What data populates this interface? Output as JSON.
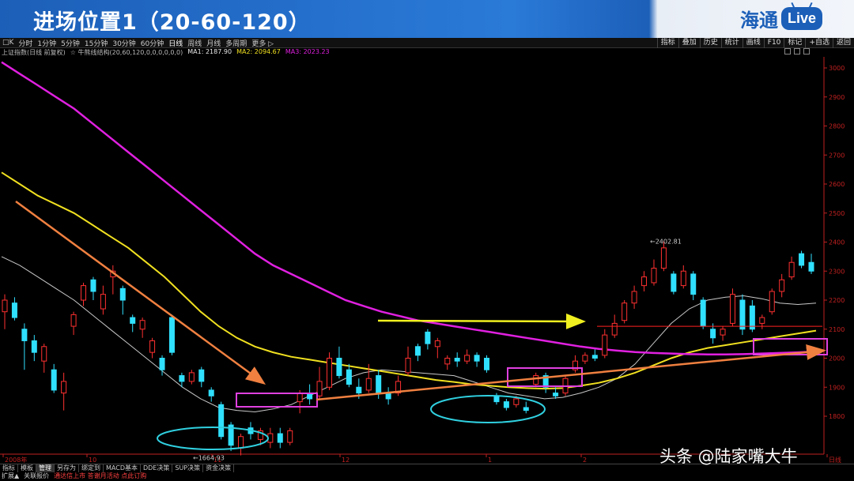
{
  "banner": {
    "title": "进场位置1（20-60-120）",
    "logo_text": "海通",
    "logo_badge": "Live"
  },
  "toolbar": {
    "left_marker": "□K",
    "periods": [
      "分时",
      "1分钟",
      "5分钟",
      "15分钟",
      "30分钟",
      "60分钟",
      "日线",
      "周线",
      "月线",
      "多周期",
      "更多 ▷"
    ],
    "active_period": "日线",
    "right_buttons": [
      "指标",
      "叠加",
      "历史",
      "统计",
      "画线",
      "F10",
      "标记",
      "+自选",
      "返回"
    ]
  },
  "infobar": {
    "index_name": "上证指数(日线 前复权)",
    "indicator": "☆ 牛熊线结构(20,60,120,0,0,0,0,0,0)",
    "ma1": "MA1: 2187.90",
    "ma2": "MA2: 2094.67",
    "ma3": "MA3: 2023.23"
  },
  "bottom_tabs": [
    "指标",
    "模板",
    "管理",
    "另存为",
    "绑定到",
    "MACD基本",
    "DDE决策",
    "SUP决策",
    "资金决策"
  ],
  "active_bottom_tab": "管理",
  "status_bar": {
    "item1": "扩展▲",
    "item2": "关联报价",
    "item3": "通达信上市 答谢月活动 点此订购"
  },
  "watermark": "头条 @陆家嘴大牛",
  "colors": {
    "up": "#ff3030",
    "down": "#30e0ff",
    "ma1": "#c8c8c8",
    "ma2": "#f0e020",
    "ma3": "#e020e0",
    "axis": "#c02020",
    "grid_text": "#c02020",
    "highlight_box": "#e040e0",
    "oval": "#30d0e0",
    "arrow_orange": "#f08040",
    "arrow_yellow": "#f0f020"
  },
  "chart_data": {
    "type": "candlestick",
    "title": "上证指数(日线 前复权)",
    "ylim": [
      1600,
      3050
    ],
    "y_ticks": [
      1800,
      1900,
      2000,
      2100,
      2200,
      2300,
      2400,
      2500,
      2600,
      2700,
      2800,
      2900,
      3000
    ],
    "x_tick_labels": [
      "2008年",
      "10",
      "11",
      "12",
      "1",
      "2",
      "日线"
    ],
    "annotations": {
      "low_label": "←1664.93",
      "high_label": "←2402.81",
      "low_value": 1664.93,
      "high_value": 2402.81
    },
    "ma_series": [
      {
        "name": "MA1",
        "values": [
          2350,
          2320,
          2280,
          2240,
          2200,
          2150,
          2100,
          2050,
          2000,
          1950,
          1900,
          1860,
          1830,
          1820,
          1815,
          1825,
          1840,
          1870,
          1900,
          1930,
          1950,
          1960,
          1955,
          1950,
          1945,
          1940,
          1920,
          1900,
          1880,
          1870,
          1860,
          1865,
          1880,
          1900,
          1930,
          1980,
          2050,
          2120,
          2170,
          2200,
          2210,
          2215,
          2205,
          2190,
          2185,
          2190
        ]
      },
      {
        "name": "MA2",
        "values": [
          2640,
          2600,
          2560,
          2530,
          2500,
          2460,
          2420,
          2380,
          2330,
          2280,
          2220,
          2160,
          2110,
          2070,
          2040,
          2020,
          2005,
          1995,
          1985,
          1975,
          1965,
          1955,
          1945,
          1935,
          1925,
          1918,
          1910,
          1905,
          1900,
          1897,
          1895,
          1897,
          1905,
          1915,
          1930,
          1950,
          1975,
          2000,
          2020,
          2035,
          2045,
          2055,
          2065,
          2075,
          2085,
          2095
        ]
      },
      {
        "name": "MA3",
        "values": [
          3020,
          2980,
          2940,
          2900,
          2860,
          2810,
          2760,
          2710,
          2660,
          2610,
          2560,
          2510,
          2460,
          2410,
          2360,
          2320,
          2290,
          2260,
          2230,
          2200,
          2180,
          2160,
          2145,
          2130,
          2120,
          2110,
          2100,
          2090,
          2080,
          2070,
          2060,
          2050,
          2040,
          2032,
          2026,
          2021,
          2018,
          2016,
          2014,
          2013,
          2013,
          2014,
          2016,
          2018,
          2020,
          2023
        ]
      }
    ],
    "candles": [
      {
        "o": 2160,
        "c": 2200,
        "h": 2220,
        "l": 2100
      },
      {
        "o": 2190,
        "c": 2140,
        "h": 2210,
        "l": 2130
      },
      {
        "o": 2100,
        "c": 2060,
        "h": 2120,
        "l": 1960
      },
      {
        "o": 2060,
        "c": 2020,
        "h": 2080,
        "l": 1990
      },
      {
        "o": 1990,
        "c": 2040,
        "h": 2050,
        "l": 1950
      },
      {
        "o": 1960,
        "c": 1890,
        "h": 1980,
        "l": 1880
      },
      {
        "o": 1880,
        "c": 1920,
        "h": 1950,
        "l": 1820
      },
      {
        "o": 2110,
        "c": 2150,
        "h": 2160,
        "l": 2080
      },
      {
        "o": 2200,
        "c": 2250,
        "h": 2260,
        "l": 2180
      },
      {
        "o": 2270,
        "c": 2230,
        "h": 2280,
        "l": 2200
      },
      {
        "o": 2170,
        "c": 2220,
        "h": 2250,
        "l": 2150
      },
      {
        "o": 2280,
        "c": 2300,
        "h": 2320,
        "l": 2220
      },
      {
        "o": 2240,
        "c": 2200,
        "h": 2250,
        "l": 2150
      },
      {
        "o": 2140,
        "c": 2120,
        "h": 2150,
        "l": 2090
      },
      {
        "o": 2100,
        "c": 2130,
        "h": 2140,
        "l": 2070
      },
      {
        "o": 2020,
        "c": 2060,
        "h": 2070,
        "l": 2000
      },
      {
        "o": 2000,
        "c": 1960,
        "h": 2010,
        "l": 1940
      },
      {
        "o": 2140,
        "c": 2020,
        "h": 2150,
        "l": 2010
      },
      {
        "o": 1940,
        "c": 1920,
        "h": 1950,
        "l": 1900
      },
      {
        "o": 1920,
        "c": 1950,
        "h": 1960,
        "l": 1910
      },
      {
        "o": 1960,
        "c": 1920,
        "h": 1970,
        "l": 1900
      },
      {
        "o": 1890,
        "c": 1870,
        "h": 1900,
        "l": 1850
      },
      {
        "o": 1840,
        "c": 1730,
        "h": 1850,
        "l": 1720
      },
      {
        "o": 1770,
        "c": 1700,
        "h": 1780,
        "l": 1680
      },
      {
        "o": 1690,
        "c": 1730,
        "h": 1740,
        "l": 1665
      },
      {
        "o": 1760,
        "c": 1740,
        "h": 1780,
        "l": 1720
      },
      {
        "o": 1720,
        "c": 1750,
        "h": 1760,
        "l": 1700
      },
      {
        "o": 1710,
        "c": 1740,
        "h": 1760,
        "l": 1690
      },
      {
        "o": 1740,
        "c": 1710,
        "h": 1760,
        "l": 1690
      },
      {
        "o": 1710,
        "c": 1750,
        "h": 1760,
        "l": 1700
      },
      {
        "o": 1850,
        "c": 1880,
        "h": 1890,
        "l": 1810
      },
      {
        "o": 1880,
        "c": 1860,
        "h": 1910,
        "l": 1840
      },
      {
        "o": 1870,
        "c": 1920,
        "h": 1970,
        "l": 1860
      },
      {
        "o": 1900,
        "c": 2000,
        "h": 2020,
        "l": 1890
      },
      {
        "o": 2000,
        "c": 1940,
        "h": 2040,
        "l": 1930
      },
      {
        "o": 1960,
        "c": 1910,
        "h": 1980,
        "l": 1900
      },
      {
        "o": 1900,
        "c": 1880,
        "h": 1930,
        "l": 1860
      },
      {
        "o": 1890,
        "c": 1930,
        "h": 1980,
        "l": 1880
      },
      {
        "o": 1940,
        "c": 1880,
        "h": 1960,
        "l": 1860
      },
      {
        "o": 1880,
        "c": 1860,
        "h": 1900,
        "l": 1840
      },
      {
        "o": 1880,
        "c": 1920,
        "h": 1940,
        "l": 1870
      },
      {
        "o": 1950,
        "c": 2000,
        "h": 2040,
        "l": 1940
      },
      {
        "o": 2040,
        "c": 2010,
        "h": 2050,
        "l": 1990
      },
      {
        "o": 2090,
        "c": 2050,
        "h": 2100,
        "l": 2030
      },
      {
        "o": 2040,
        "c": 2060,
        "h": 2070,
        "l": 2000
      },
      {
        "o": 1980,
        "c": 2000,
        "h": 2010,
        "l": 1960
      },
      {
        "o": 2000,
        "c": 1990,
        "h": 2020,
        "l": 1970
      },
      {
        "o": 1990,
        "c": 2010,
        "h": 2030,
        "l": 1980
      },
      {
        "o": 2010,
        "c": 1990,
        "h": 2020,
        "l": 1970
      },
      {
        "o": 2000,
        "c": 1960,
        "h": 2010,
        "l": 1950
      },
      {
        "o": 1870,
        "c": 1850,
        "h": 1880,
        "l": 1840
      },
      {
        "o": 1850,
        "c": 1830,
        "h": 1860,
        "l": 1820
      },
      {
        "o": 1840,
        "c": 1860,
        "h": 1870,
        "l": 1830
      },
      {
        "o": 1830,
        "c": 1820,
        "h": 1850,
        "l": 1810
      },
      {
        "o": 1910,
        "c": 1940,
        "h": 1950,
        "l": 1900
      },
      {
        "o": 1940,
        "c": 1900,
        "h": 1950,
        "l": 1880
      },
      {
        "o": 1880,
        "c": 1870,
        "h": 1900,
        "l": 1860
      },
      {
        "o": 1880,
        "c": 1930,
        "h": 1940,
        "l": 1870
      },
      {
        "o": 1960,
        "c": 1990,
        "h": 2010,
        "l": 1950
      },
      {
        "o": 1990,
        "c": 2010,
        "h": 2020,
        "l": 1980
      },
      {
        "o": 2010,
        "c": 2000,
        "h": 2030,
        "l": 1990
      },
      {
        "o": 2010,
        "c": 2080,
        "h": 2100,
        "l": 2000
      },
      {
        "o": 2080,
        "c": 2120,
        "h": 2150,
        "l": 2070
      },
      {
        "o": 2130,
        "c": 2190,
        "h": 2200,
        "l": 2120
      },
      {
        "o": 2190,
        "c": 2230,
        "h": 2250,
        "l": 2170
      },
      {
        "o": 2250,
        "c": 2280,
        "h": 2300,
        "l": 2230
      },
      {
        "o": 2260,
        "c": 2310,
        "h": 2340,
        "l": 2250
      },
      {
        "o": 2310,
        "c": 2380,
        "h": 2403,
        "l": 2300
      },
      {
        "o": 2290,
        "c": 2230,
        "h": 2300,
        "l": 2220
      },
      {
        "o": 2250,
        "c": 2300,
        "h": 2320,
        "l": 2240
      },
      {
        "o": 2290,
        "c": 2220,
        "h": 2300,
        "l": 2200
      },
      {
        "o": 2200,
        "c": 2110,
        "h": 2210,
        "l": 2100
      },
      {
        "o": 2100,
        "c": 2070,
        "h": 2120,
        "l": 2050
      },
      {
        "o": 2080,
        "c": 2100,
        "h": 2110,
        "l": 2060
      },
      {
        "o": 2120,
        "c": 2220,
        "h": 2240,
        "l": 2110
      },
      {
        "o": 2200,
        "c": 2100,
        "h": 2220,
        "l": 2080
      },
      {
        "o": 2180,
        "c": 2100,
        "h": 2200,
        "l": 2090
      },
      {
        "o": 2120,
        "c": 2140,
        "h": 2150,
        "l": 2100
      },
      {
        "o": 2160,
        "c": 2230,
        "h": 2240,
        "l": 2150
      },
      {
        "o": 2230,
        "c": 2270,
        "h": 2290,
        "l": 2210
      },
      {
        "o": 2280,
        "c": 2330,
        "h": 2350,
        "l": 2270
      },
      {
        "o": 2360,
        "c": 2320,
        "h": 2370,
        "l": 2310
      },
      {
        "o": 2330,
        "c": 2300,
        "h": 2360,
        "l": 2290
      }
    ]
  }
}
